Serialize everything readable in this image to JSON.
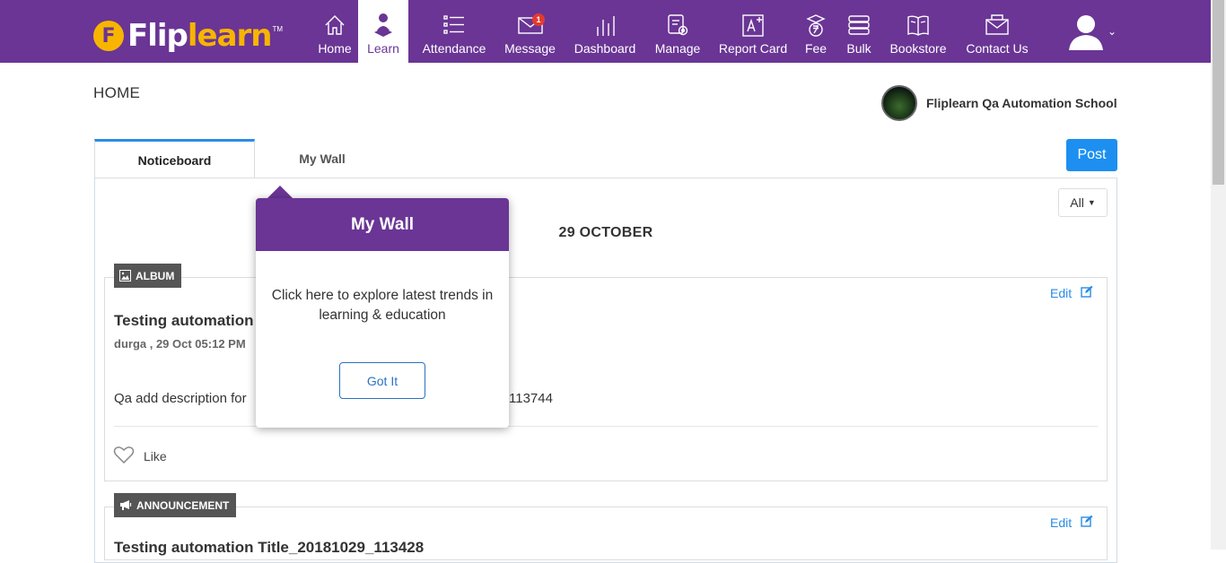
{
  "brand": {
    "logo_white": "Flip",
    "logo_yellow": "learn",
    "tm": "TM",
    "badge_letter": "F"
  },
  "nav": {
    "home": "Home",
    "learn": "Learn",
    "attendance": "Attendance",
    "message": "Message",
    "message_badge": "1",
    "dashboard": "Dashboard",
    "manage": "Manage",
    "report_card": "Report Card",
    "fee": "Fee",
    "bulk": "Bulk",
    "bookstore": "Bookstore",
    "contact_us": "Contact Us"
  },
  "colors": {
    "brand_purple": "#6a3595",
    "accent_blue": "#1d8ff0",
    "logo_yellow": "#f7b500"
  },
  "page": {
    "title": "HOME",
    "school_name": "Fliplearn Qa Automation School"
  },
  "tabs": [
    {
      "label": "Noticeboard"
    },
    {
      "label": "My Wall"
    }
  ],
  "toolbar": {
    "post_label": "Post",
    "filter_value": "All"
  },
  "feed": {
    "date_heading": "29 OCTOBER",
    "posts": [
      {
        "tag": "ALBUM",
        "edit_label": "Edit",
        "title": "Testing automation",
        "meta": "durga , 29 Oct 05:12 PM",
        "description": "Qa add description for",
        "description_tail": "113744",
        "like_label": "Like"
      },
      {
        "tag": "ANNOUNCEMENT",
        "edit_label": "Edit",
        "title": "Testing automation Title_20181029_113428"
      }
    ]
  },
  "popover": {
    "title": "My Wall",
    "body": "Click here to explore latest trends in learning & education",
    "button": "Got It"
  }
}
